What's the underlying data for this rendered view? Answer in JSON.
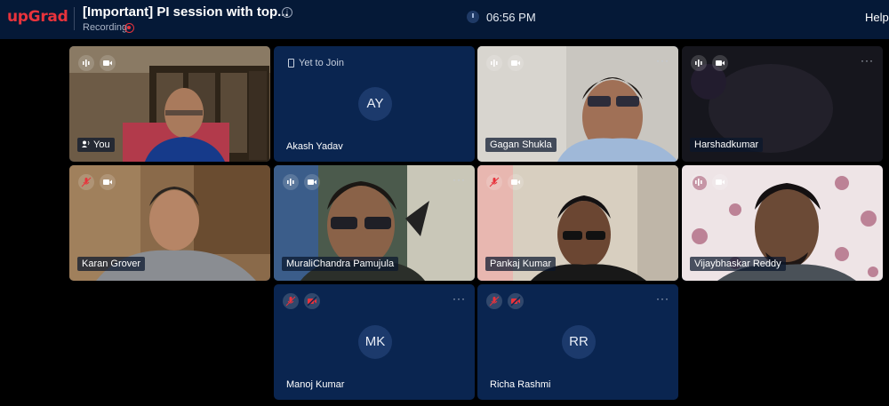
{
  "header": {
    "logo": "upGrad",
    "title": "[Important] PI session with top...",
    "recording": "Recording",
    "time": "06:56 PM",
    "help": "Help"
  },
  "participants": [
    {
      "name": "You",
      "mic": "unmuted",
      "camera": "on"
    },
    {
      "name": "Akash Yadav",
      "status": "Yet to Join",
      "initials": "AY"
    },
    {
      "name": "Gagan Shukla",
      "mic": "unmuted",
      "camera": "on"
    },
    {
      "name": "Harshadkumar",
      "mic": "unmuted",
      "camera": "on"
    },
    {
      "name": "Karan Grover",
      "mic": "muted",
      "camera": "on"
    },
    {
      "name": "MuraliChandra Pamujula",
      "mic": "unmuted",
      "camera": "on"
    },
    {
      "name": "Pankaj Kumar",
      "mic": "muted",
      "camera": "on"
    },
    {
      "name": "Vijaybhaskar Reddy",
      "mic": "unmuted",
      "camera": "on"
    },
    {
      "name": "Manoj Kumar",
      "initials": "MK",
      "mic": "muted",
      "camera": "off"
    },
    {
      "name": "Richa Rashmi",
      "initials": "RR",
      "mic": "muted",
      "camera": "off"
    }
  ],
  "menu_glyph": "···",
  "info_glyph": "i",
  "colors": {
    "brand": "#e8333c",
    "header_bg": "#051937",
    "tile_bg": "#0a2550"
  }
}
